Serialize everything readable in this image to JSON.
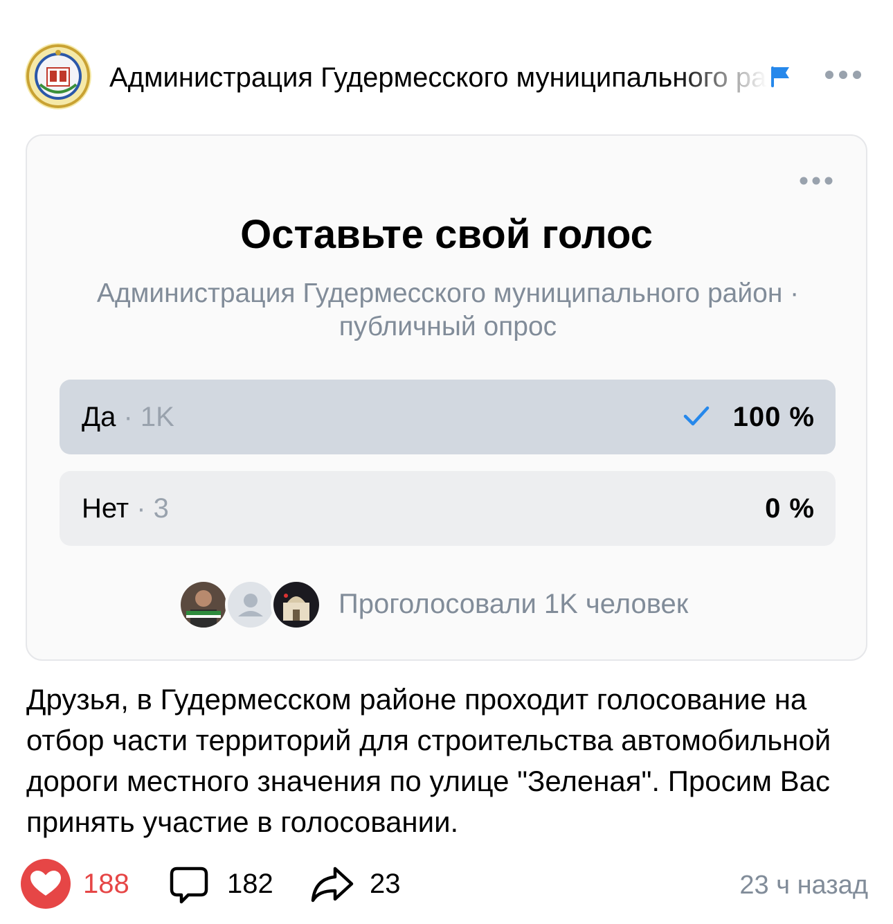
{
  "post": {
    "author": "Администрация Гудермесского муниципального района",
    "time": "23 ч назад",
    "text": "Друзья, в Гудермесском районе проходит голосование на отбор части территорий для строительства автомобильной дороги местного значения по улице \"Зеленая\". Просим Вас принять участие в голосовании."
  },
  "poll": {
    "title": "Оставьте свой голос",
    "subtitle": "Администрация Гудермесского муниципального район · публичный опрос",
    "options": [
      {
        "label": "Да",
        "count": "1K",
        "percent": "100 %",
        "fill": 1.0,
        "voted": true
      },
      {
        "label": "Нет",
        "count": "3",
        "percent": "0 %",
        "fill": 0.0,
        "voted": false
      }
    ],
    "voters_text": "Проголосовали 1K человек"
  },
  "actions": {
    "likes": "188",
    "comments": "182",
    "shares": "23"
  },
  "colors": {
    "accent": "#2688eb",
    "like": "#e64646",
    "secondary_text": "#818c99"
  },
  "icons": [
    "community-avatar",
    "flag-icon",
    "more-icon",
    "check-icon",
    "heart-icon",
    "comment-icon",
    "share-icon"
  ]
}
